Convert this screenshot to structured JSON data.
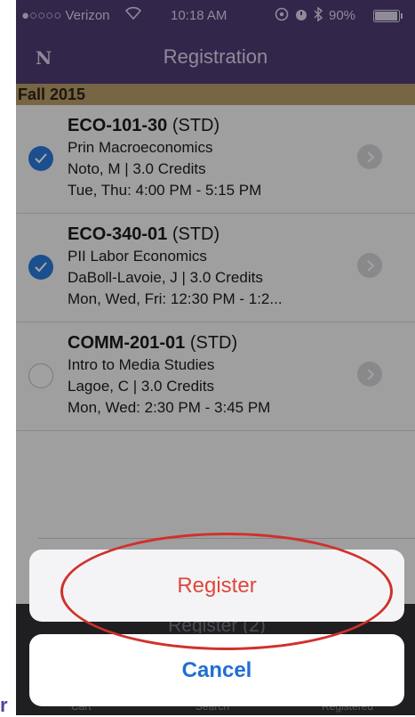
{
  "status_bar": {
    "carrier": "●○○○○ Verizon",
    "wifi_icon": "wifi-icon",
    "time": "10:18 AM",
    "battery": "90%"
  },
  "nav": {
    "logo": "N",
    "title": "Registration"
  },
  "term": "Fall 2015",
  "courses": [
    {
      "code": "ECO-101-30",
      "type": "(STD)",
      "name": "Prin Macroeconomics",
      "instructor_credits": "Noto, M | 3.0 Credits",
      "schedule": "Tue, Thu: 4:00 PM - 5:15 PM",
      "selected": true
    },
    {
      "code": "ECO-340-01",
      "type": "(STD)",
      "name": "PII Labor Economics",
      "instructor_credits": "DaBoll-Lavoie, J | 3.0 Credits",
      "schedule": "Mon, Wed, Fri: 12:30 PM - 1:2...",
      "selected": true
    },
    {
      "code": "COMM-201-01",
      "type": "(STD)",
      "name": "Intro to Media Studies",
      "instructor_credits": "Lagoe, C | 3.0 Credits",
      "schedule": "Mon, Wed: 2:30 PM - 3:45 PM",
      "selected": false
    }
  ],
  "register_behind": "Register (2)",
  "tabs": [
    "Cart",
    "Search",
    "Registered"
  ],
  "action_sheet": {
    "register": "Register",
    "cancel": "Cancel"
  },
  "left_edge_glyph": "r",
  "colors": {
    "nav_purple": "#4c3b71",
    "term_gold": "#b59a68",
    "check_blue": "#2a78d8",
    "register_red": "#e0463c",
    "cancel_blue": "#1f6fd4",
    "annotation_red": "#d0312b"
  }
}
